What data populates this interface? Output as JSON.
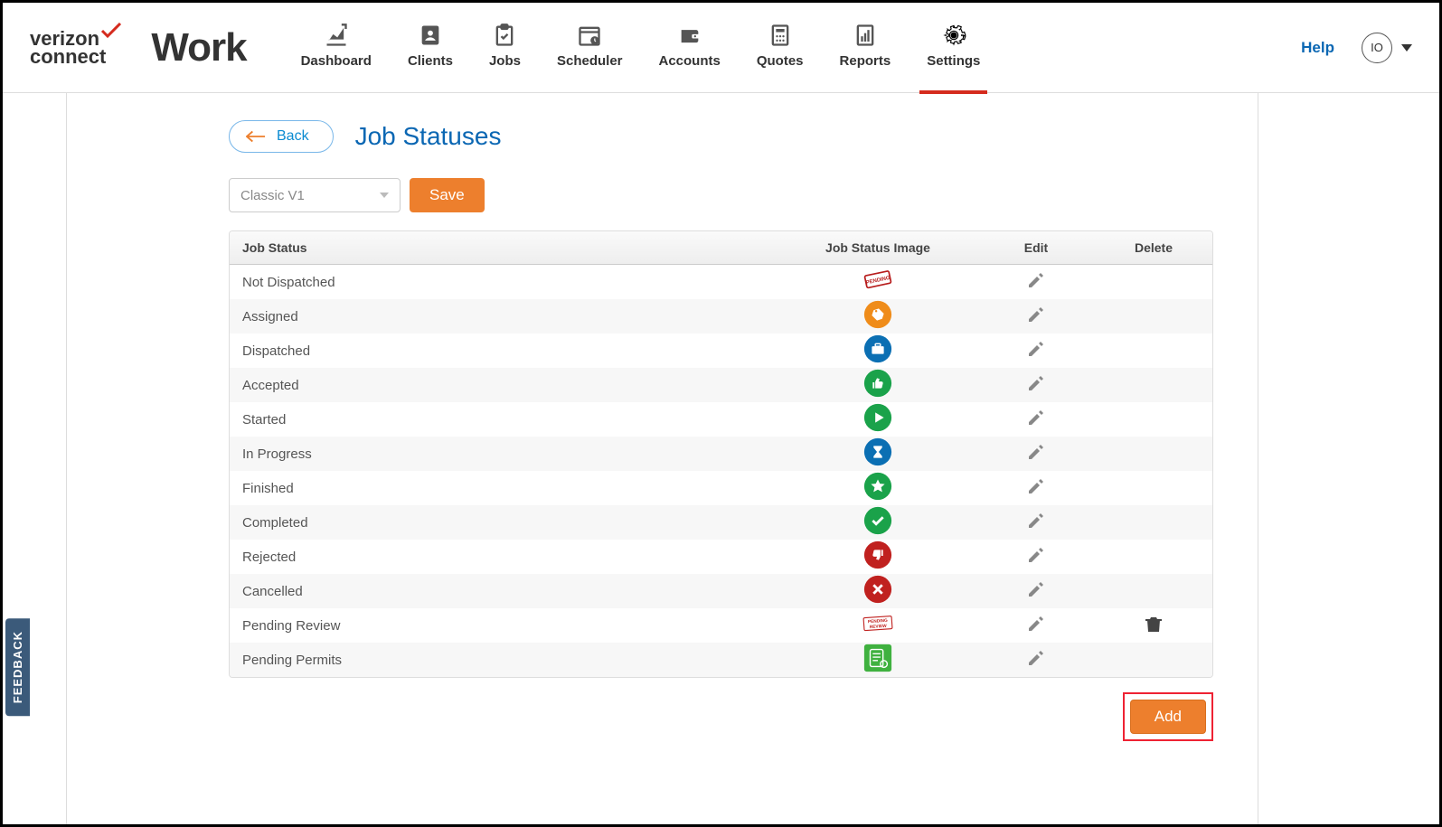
{
  "brand": {
    "line1": "verizon",
    "line2": "connect",
    "product": "Work"
  },
  "nav": [
    {
      "label": "Dashboard",
      "active": false
    },
    {
      "label": "Clients",
      "active": false
    },
    {
      "label": "Jobs",
      "active": false
    },
    {
      "label": "Scheduler",
      "active": false
    },
    {
      "label": "Accounts",
      "active": false
    },
    {
      "label": "Quotes",
      "active": false
    },
    {
      "label": "Reports",
      "active": false
    },
    {
      "label": "Settings",
      "active": true
    }
  ],
  "help_label": "Help",
  "avatar_initials": "IO",
  "back_label": "Back",
  "page_title": "Job Statuses",
  "select_value": "Classic V1",
  "save_label": "Save",
  "columns": {
    "name": "Job Status",
    "image": "Job Status Image",
    "edit": "Edit",
    "delete": "Delete"
  },
  "rows": [
    {
      "name": "Not Dispatched",
      "icon": "pending-stamp",
      "color": "#b71c1c",
      "deletable": false
    },
    {
      "name": "Assigned",
      "icon": "tag-circle",
      "color": "#ef8c1a",
      "deletable": false
    },
    {
      "name": "Dispatched",
      "icon": "briefcase-circle",
      "color": "#0b6fb3",
      "deletable": false
    },
    {
      "name": "Accepted",
      "icon": "thumbsup-circle",
      "color": "#1aa24a",
      "deletable": false
    },
    {
      "name": "Started",
      "icon": "play-circle",
      "color": "#1aa24a",
      "deletable": false
    },
    {
      "name": "In Progress",
      "icon": "hourglass-circle",
      "color": "#0b6fb3",
      "deletable": false
    },
    {
      "name": "Finished",
      "icon": "star-circle",
      "color": "#1aa24a",
      "deletable": false
    },
    {
      "name": "Completed",
      "icon": "check-circle",
      "color": "#1aa24a",
      "deletable": false
    },
    {
      "name": "Rejected",
      "icon": "thumbsdown-circle",
      "color": "#c0211f",
      "deletable": false
    },
    {
      "name": "Cancelled",
      "icon": "x-circle",
      "color": "#c0211f",
      "deletable": false
    },
    {
      "name": "Pending Review",
      "icon": "pending-review-stamp",
      "color": "#c0211f",
      "deletable": true
    },
    {
      "name": "Pending Permits",
      "icon": "doc-square",
      "color": "#3fb13f",
      "deletable": false
    }
  ],
  "add_label": "Add",
  "feedback_label": "FEEDBACK"
}
